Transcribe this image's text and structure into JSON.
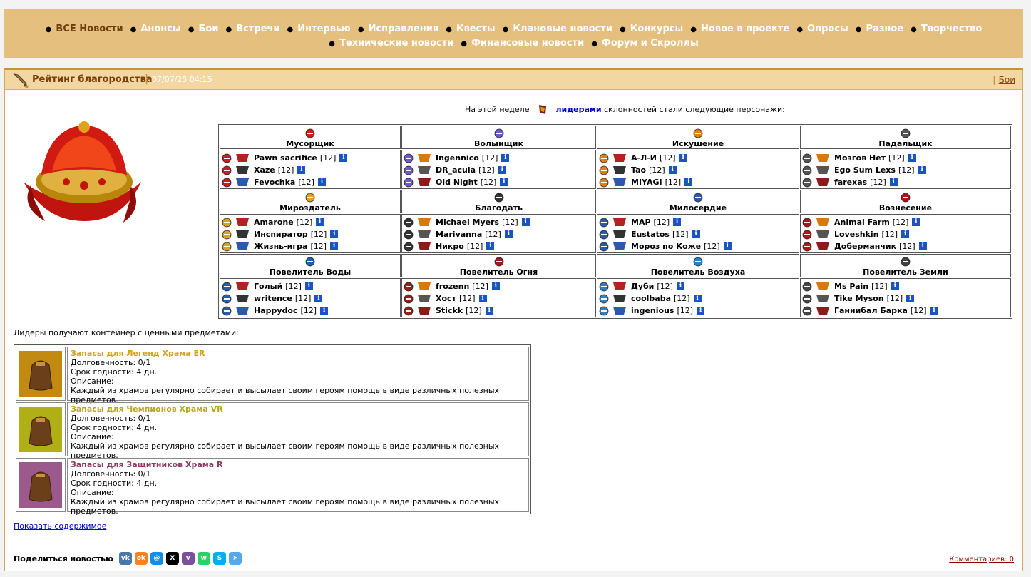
{
  "nav": {
    "row1": [
      "ВСЕ Новости",
      "Анонсы",
      "Бои",
      "Встречи",
      "Интервью",
      "Исправления",
      "Квесты",
      "Клановые новости",
      "Конкурсы",
      "Новое в проекте",
      "Опросы",
      "Разное",
      "Творчество"
    ],
    "row2": [
      "Технические новости",
      "Финансовые новости",
      "Форум и Скроллы"
    ]
  },
  "header": {
    "title": "Рейтинг благородства",
    "separator": "|",
    "date": "07/07/25 04:15",
    "category_link": "Бои"
  },
  "intro": {
    "before": "На этой неделе",
    "link": "лидерами",
    "after": "склонностей стали следующие персонажи:"
  },
  "alignments": [
    [
      {
        "title": "Мусорщик",
        "color": "#d4191b",
        "people": [
          {
            "name": "Pawn sacrifice",
            "level": "[12]"
          },
          {
            "name": "Xaze",
            "level": "[12]"
          },
          {
            "name": "Fevochka",
            "level": "[12]"
          }
        ]
      },
      {
        "title": "Волынщик",
        "color": "#6a5acd",
        "people": [
          {
            "name": "Ingennico",
            "level": "[12]"
          },
          {
            "name": "DR_acula",
            "level": "[12]"
          },
          {
            "name": "Old Night",
            "level": "[12]"
          }
        ]
      },
      {
        "title": "Искушение",
        "color": "#e37e0b",
        "people": [
          {
            "name": "А-Л-И",
            "level": "[12]"
          },
          {
            "name": "Tao",
            "level": "[12]"
          },
          {
            "name": "MIYAGI",
            "level": "[12]"
          }
        ]
      },
      {
        "title": "Падальщик",
        "color": "#555555",
        "people": [
          {
            "name": "Мозгов Нет",
            "level": "[12]"
          },
          {
            "name": "Ego Sum Lexs",
            "level": "[12]"
          },
          {
            "name": "farexas",
            "level": "[12]"
          }
        ]
      }
    ],
    [
      {
        "title": "Мироздатель",
        "color": "#e0a21c",
        "people": [
          {
            "name": "Amarone",
            "level": "[12]"
          },
          {
            "name": "Инспиратор",
            "level": "[12]"
          },
          {
            "name": "Жизнь-игра",
            "level": "[12]"
          }
        ]
      },
      {
        "title": "Благодать",
        "color": "#333333",
        "people": [
          {
            "name": "Michael Myers",
            "level": "[12]"
          },
          {
            "name": "Marivanna",
            "level": "[12]"
          },
          {
            "name": "Никро",
            "level": "[12]"
          }
        ]
      },
      {
        "title": "Милосердие",
        "color": "#2b5aa8",
        "people": [
          {
            "name": "MAP",
            "level": "[12]"
          },
          {
            "name": "Eustatos",
            "level": "[12]"
          },
          {
            "name": "Мороз по Коже",
            "level": "[12]"
          }
        ]
      },
      {
        "title": "Вознесение",
        "color": "#b3121a",
        "people": [
          {
            "name": "Animal Farm",
            "level": "[12]"
          },
          {
            "name": "Loveshkin",
            "level": "[12]"
          },
          {
            "name": "Доберманчик",
            "level": "[12]"
          }
        ]
      }
    ],
    [
      {
        "title": "Повелитель Воды",
        "color": "#1f5fb0",
        "people": [
          {
            "name": "Голый",
            "level": "[12]"
          },
          {
            "name": "writence",
            "level": "[12]"
          },
          {
            "name": "Happydoc",
            "level": "[12]"
          }
        ]
      },
      {
        "title": "Повелитель Огня",
        "color": "#a01a1a",
        "people": [
          {
            "name": "frozenn",
            "level": "[12]"
          },
          {
            "name": "Хост",
            "level": "[12]"
          },
          {
            "name": "Stickk",
            "level": "[12]"
          }
        ]
      },
      {
        "title": "Повелитель Воздуха",
        "color": "#2a7fc9",
        "people": [
          {
            "name": "Дуби",
            "level": "[12]"
          },
          {
            "name": "coolbaba",
            "level": "[12]"
          },
          {
            "name": "ingenious",
            "level": "[12]"
          }
        ]
      },
      {
        "title": "Повелитель Земли",
        "color": "#444444",
        "people": [
          {
            "name": "Ms Pain",
            "level": "[12]"
          },
          {
            "name": "Tike Myson",
            "level": "[12]"
          },
          {
            "name": "Ганнибал Барка",
            "level": "[12]"
          }
        ]
      }
    ]
  ],
  "leaders_note": "Лидеры получают контейнер с ценными предметами:",
  "prizes": [
    {
      "name": "Запасы для Легенд Храма ER",
      "name_color": "#d4a017",
      "bg": "#c28a10",
      "durability": "Долговечность: 0/1",
      "expiry": "Срок годности: 4 дн.",
      "desc_label": "Описание:",
      "desc": "Каждый из храмов регулярно собирает и высылает своим героям помощь в виде различных полезных предметов."
    },
    {
      "name": "Запасы для Чемпионов Храма VR",
      "name_color": "#b5a81a",
      "bg": "#b0b016",
      "durability": "Долговечность: 0/1",
      "expiry": "Срок годности: 4 дн.",
      "desc_label": "Описание:",
      "desc": "Каждый из храмов регулярно собирает и высылает своим героям помощь в виде различных полезных предметов."
    },
    {
      "name": "Запасы для Защитников Храма R",
      "name_color": "#8b3a62",
      "bg": "#9c5a8c",
      "durability": "Долговечность: 0/1",
      "expiry": "Срок годности: 4 дн.",
      "desc_label": "Описание:",
      "desc": "Каждый из храмов регулярно собирает и высылает своим героям помощь в виде различных полезных предметов."
    }
  ],
  "show_contents": "Показать содержимое",
  "share": {
    "label": "Поделиться новостью",
    "networks": [
      {
        "icon": "vk-icon",
        "text": "vk",
        "color": "#4a76a8"
      },
      {
        "icon": "odnoklassniki-icon",
        "text": "ok",
        "color": "#f58220"
      },
      {
        "icon": "moimir-icon",
        "text": "@",
        "color": "#168de2"
      },
      {
        "icon": "x-icon",
        "text": "X",
        "color": "#000000"
      },
      {
        "icon": "viber-icon",
        "text": "v",
        "color": "#7b519d"
      },
      {
        "icon": "whatsapp-icon",
        "text": "w",
        "color": "#25d366"
      },
      {
        "icon": "skype-icon",
        "text": "S",
        "color": "#00aff0"
      },
      {
        "icon": "telegram-icon",
        "text": "➤",
        "color": "#54a9eb"
      }
    ]
  },
  "comments": "Комментариев: 0"
}
